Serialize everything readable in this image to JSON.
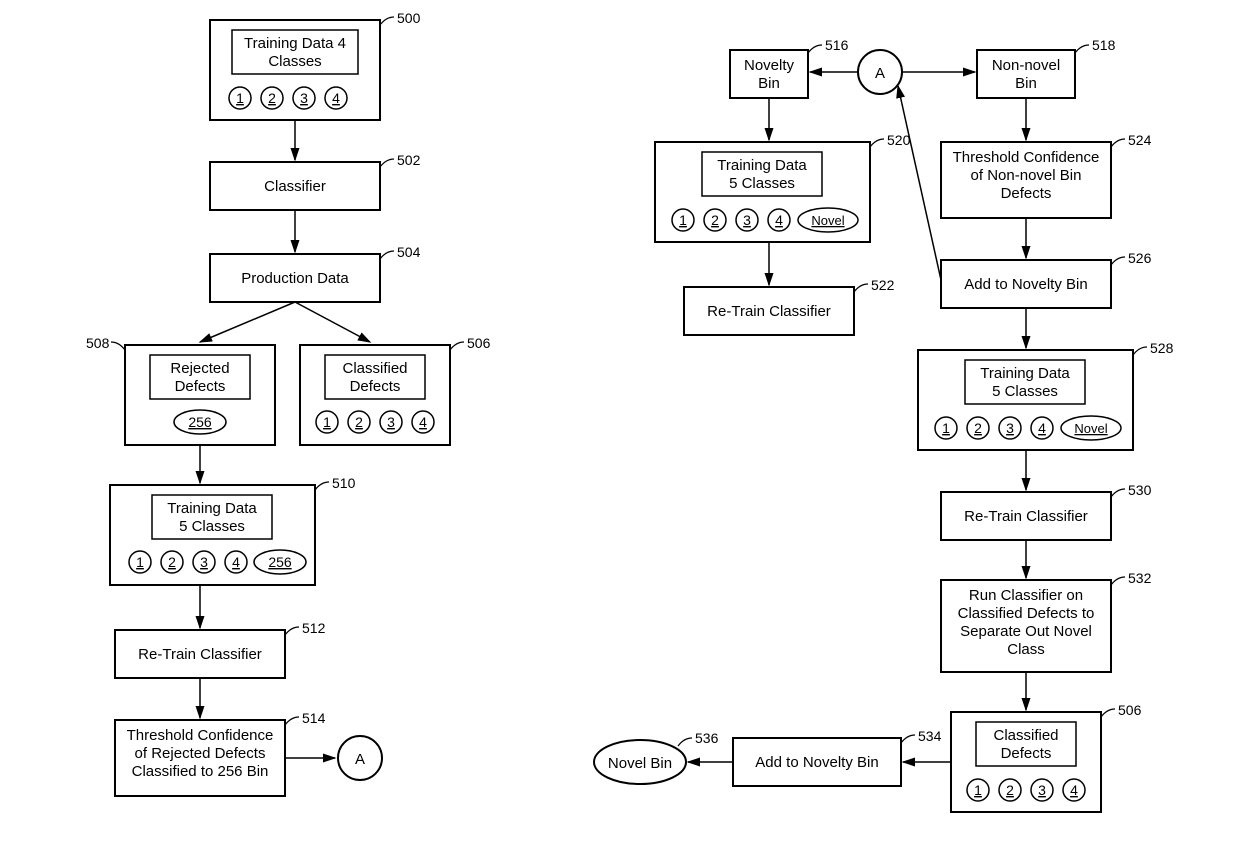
{
  "refs": {
    "r500": "500",
    "r502": "502",
    "r504": "504",
    "r506": "506",
    "r508": "508",
    "r510": "510",
    "r512": "512",
    "r514": "514",
    "r516": "516",
    "r518": "518",
    "r520": "520",
    "r522": "522",
    "r524": "524",
    "r526": "526",
    "r528": "528",
    "r530": "530",
    "r532": "532",
    "r534": "534",
    "r536": "536",
    "r506b": "506"
  },
  "labels": {
    "training4_l1": "Training Data 4",
    "training4_l2": "Classes",
    "classifier": "Classifier",
    "production": "Production Data",
    "rejected_l1": "Rejected",
    "rejected_l2": "Defects",
    "classified_l1": "Classified",
    "classified_l2": "Defects",
    "training5_l1": "Training Data",
    "training5_l2": "5 Classes",
    "retrain": "Re-Train Classifier",
    "thresh_rej_l1": "Threshold Confidence",
    "thresh_rej_l2": "of Rejected Defects",
    "thresh_rej_l3": "Classified to 256 Bin",
    "novelty_l1": "Novelty",
    "novelty_l2": "Bin",
    "nonnovel_l1": "Non-novel",
    "nonnovel_l2": "Bin",
    "thresh_non_l1": "Threshold Confidence",
    "thresh_non_l2": "of Non-novel Bin",
    "thresh_non_l3": "Defects",
    "add_novelty": "Add to Novelty Bin",
    "run_l1": "Run Classifier on",
    "run_l2": "Classified Defects to",
    "run_l3": "Separate Out Novel",
    "run_l4": "Class",
    "novel_bin": "Novel Bin",
    "connA": "A"
  },
  "nums": {
    "c1": "1",
    "c2": "2",
    "c3": "3",
    "c4": "4",
    "c256": "256",
    "novel": "Novel"
  }
}
